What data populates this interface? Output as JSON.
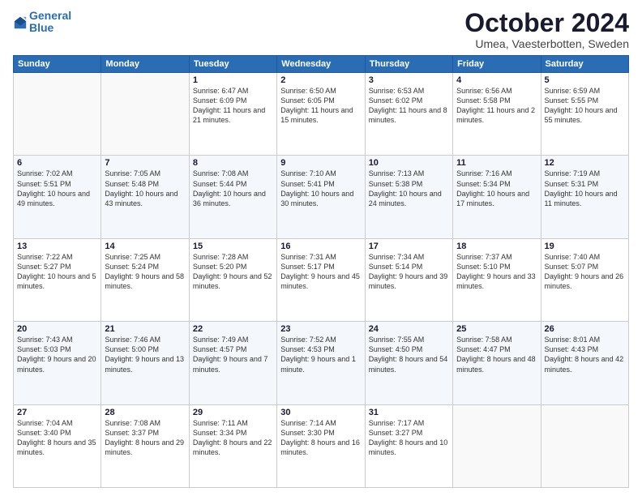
{
  "header": {
    "logo_line1": "General",
    "logo_line2": "Blue",
    "month": "October 2024",
    "location": "Umea, Vaesterbotten, Sweden"
  },
  "days_of_week": [
    "Sunday",
    "Monday",
    "Tuesday",
    "Wednesday",
    "Thursday",
    "Friday",
    "Saturday"
  ],
  "weeks": [
    [
      {
        "day": "",
        "info": ""
      },
      {
        "day": "",
        "info": ""
      },
      {
        "day": "1",
        "info": "Sunrise: 6:47 AM\nSunset: 6:09 PM\nDaylight: 11 hours and 21 minutes."
      },
      {
        "day": "2",
        "info": "Sunrise: 6:50 AM\nSunset: 6:05 PM\nDaylight: 11 hours and 15 minutes."
      },
      {
        "day": "3",
        "info": "Sunrise: 6:53 AM\nSunset: 6:02 PM\nDaylight: 11 hours and 8 minutes."
      },
      {
        "day": "4",
        "info": "Sunrise: 6:56 AM\nSunset: 5:58 PM\nDaylight: 11 hours and 2 minutes."
      },
      {
        "day": "5",
        "info": "Sunrise: 6:59 AM\nSunset: 5:55 PM\nDaylight: 10 hours and 55 minutes."
      }
    ],
    [
      {
        "day": "6",
        "info": "Sunrise: 7:02 AM\nSunset: 5:51 PM\nDaylight: 10 hours and 49 minutes."
      },
      {
        "day": "7",
        "info": "Sunrise: 7:05 AM\nSunset: 5:48 PM\nDaylight: 10 hours and 43 minutes."
      },
      {
        "day": "8",
        "info": "Sunrise: 7:08 AM\nSunset: 5:44 PM\nDaylight: 10 hours and 36 minutes."
      },
      {
        "day": "9",
        "info": "Sunrise: 7:10 AM\nSunset: 5:41 PM\nDaylight: 10 hours and 30 minutes."
      },
      {
        "day": "10",
        "info": "Sunrise: 7:13 AM\nSunset: 5:38 PM\nDaylight: 10 hours and 24 minutes."
      },
      {
        "day": "11",
        "info": "Sunrise: 7:16 AM\nSunset: 5:34 PM\nDaylight: 10 hours and 17 minutes."
      },
      {
        "day": "12",
        "info": "Sunrise: 7:19 AM\nSunset: 5:31 PM\nDaylight: 10 hours and 11 minutes."
      }
    ],
    [
      {
        "day": "13",
        "info": "Sunrise: 7:22 AM\nSunset: 5:27 PM\nDaylight: 10 hours and 5 minutes."
      },
      {
        "day": "14",
        "info": "Sunrise: 7:25 AM\nSunset: 5:24 PM\nDaylight: 9 hours and 58 minutes."
      },
      {
        "day": "15",
        "info": "Sunrise: 7:28 AM\nSunset: 5:20 PM\nDaylight: 9 hours and 52 minutes."
      },
      {
        "day": "16",
        "info": "Sunrise: 7:31 AM\nSunset: 5:17 PM\nDaylight: 9 hours and 45 minutes."
      },
      {
        "day": "17",
        "info": "Sunrise: 7:34 AM\nSunset: 5:14 PM\nDaylight: 9 hours and 39 minutes."
      },
      {
        "day": "18",
        "info": "Sunrise: 7:37 AM\nSunset: 5:10 PM\nDaylight: 9 hours and 33 minutes."
      },
      {
        "day": "19",
        "info": "Sunrise: 7:40 AM\nSunset: 5:07 PM\nDaylight: 9 hours and 26 minutes."
      }
    ],
    [
      {
        "day": "20",
        "info": "Sunrise: 7:43 AM\nSunset: 5:03 PM\nDaylight: 9 hours and 20 minutes."
      },
      {
        "day": "21",
        "info": "Sunrise: 7:46 AM\nSunset: 5:00 PM\nDaylight: 9 hours and 13 minutes."
      },
      {
        "day": "22",
        "info": "Sunrise: 7:49 AM\nSunset: 4:57 PM\nDaylight: 9 hours and 7 minutes."
      },
      {
        "day": "23",
        "info": "Sunrise: 7:52 AM\nSunset: 4:53 PM\nDaylight: 9 hours and 1 minute."
      },
      {
        "day": "24",
        "info": "Sunrise: 7:55 AM\nSunset: 4:50 PM\nDaylight: 8 hours and 54 minutes."
      },
      {
        "day": "25",
        "info": "Sunrise: 7:58 AM\nSunset: 4:47 PM\nDaylight: 8 hours and 48 minutes."
      },
      {
        "day": "26",
        "info": "Sunrise: 8:01 AM\nSunset: 4:43 PM\nDaylight: 8 hours and 42 minutes."
      }
    ],
    [
      {
        "day": "27",
        "info": "Sunrise: 7:04 AM\nSunset: 3:40 PM\nDaylight: 8 hours and 35 minutes."
      },
      {
        "day": "28",
        "info": "Sunrise: 7:08 AM\nSunset: 3:37 PM\nDaylight: 8 hours and 29 minutes."
      },
      {
        "day": "29",
        "info": "Sunrise: 7:11 AM\nSunset: 3:34 PM\nDaylight: 8 hours and 22 minutes."
      },
      {
        "day": "30",
        "info": "Sunrise: 7:14 AM\nSunset: 3:30 PM\nDaylight: 8 hours and 16 minutes."
      },
      {
        "day": "31",
        "info": "Sunrise: 7:17 AM\nSunset: 3:27 PM\nDaylight: 8 hours and 10 minutes."
      },
      {
        "day": "",
        "info": ""
      },
      {
        "day": "",
        "info": ""
      }
    ]
  ]
}
